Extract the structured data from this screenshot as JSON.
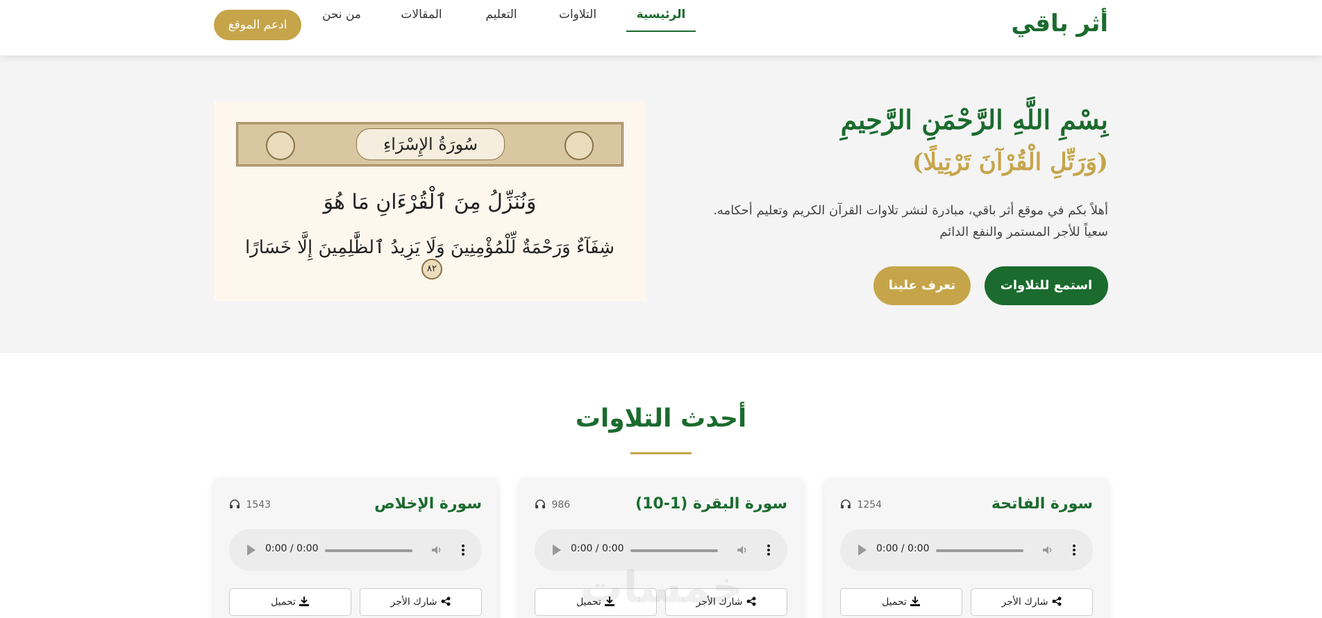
{
  "brand": {
    "logo": "أثر باقي",
    "primary_color": "#1b6b2e",
    "accent_color": "#c6a54a"
  },
  "nav": {
    "items": [
      {
        "label": "الرئيسية",
        "active": true
      },
      {
        "label": "التلاوات"
      },
      {
        "label": "التعليم"
      },
      {
        "label": "المقالات"
      },
      {
        "label": "من نحن"
      }
    ],
    "support_label": "ادعم الموقع"
  },
  "hero": {
    "title": "بِسْمِ اللَّهِ الرَّحْمَنِ الرَّحِيمِ",
    "verse": "(وَرَتِّلِ الْقُرْآنَ تَرْتِيلًا)",
    "description_line1": "أهلاً بكم في موقع أثر باقي، مبادرة لنشر تلاوات القرآن الكريم وتعليم أحكامه.",
    "description_line2": "سعياً للأجر المستمر والنفع الدائم",
    "primary_button": "استمع للتلاوات",
    "secondary_button": "تعرف علينا",
    "image": {
      "surah_name": "سُورَةُ الإِسْرَاءِ",
      "ayah_line1": "وَنُنَزِّلُ مِنَ ٱلْقُرْءَانِ مَا هُوَ",
      "ayah_line2": "شِفَآءٌ وَرَحْمَةٌ لِّلْمُؤْمِنِينَ وَلَا يَزِيدُ ٱلظَّٰلِمِينَ إِلَّا خَسَارًا",
      "ayah_number": "٨٢"
    }
  },
  "latest": {
    "title": "أحدث التلاوات",
    "cards": [
      {
        "title": "سورة الفاتحة",
        "plays": "1254",
        "time": "0:00 / 0:00",
        "share_label": "شارك الأجر",
        "download_label": "تحميل"
      },
      {
        "title": "سورة البقرة (1-10)",
        "plays": "986",
        "time": "0:00 / 0:00",
        "share_label": "شارك الأجر",
        "download_label": "تحميل"
      },
      {
        "title": "سورة الإخلاص",
        "plays": "1543",
        "time": "0:00 / 0:00",
        "share_label": "شارك الأجر",
        "download_label": "تحميل"
      }
    ]
  },
  "watermark": "خمسات",
  "icons": [
    "headphones-icon",
    "play-icon",
    "volume-icon",
    "more-vertical-icon",
    "share-icon",
    "download-icon"
  ]
}
